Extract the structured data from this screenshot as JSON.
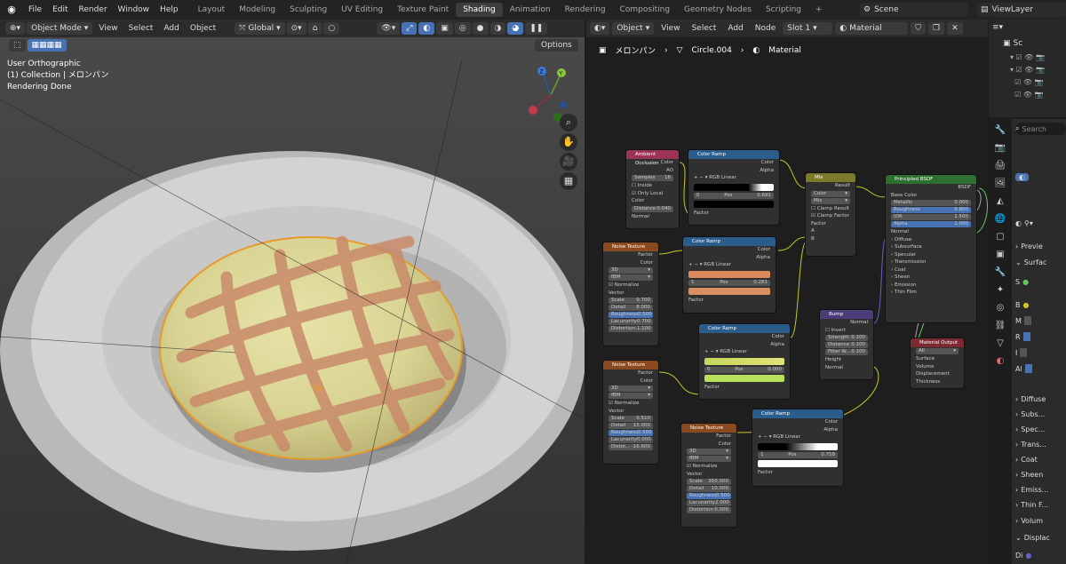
{
  "topbar": {
    "menus": [
      "File",
      "Edit",
      "Render",
      "Window",
      "Help"
    ],
    "workspaces": [
      "Layout",
      "Modeling",
      "Sculpting",
      "UV Editing",
      "Texture Paint",
      "Shading",
      "Animation",
      "Rendering",
      "Compositing",
      "Geometry Nodes",
      "Scripting"
    ],
    "active_workspace": "Shading",
    "scene": "Scene",
    "view_layer": "ViewLayer"
  },
  "viewport": {
    "mode": "Object Mode",
    "menus": [
      "View",
      "Select",
      "Add",
      "Object"
    ],
    "transform": "Global",
    "options": "Options",
    "info_lines": [
      "User Orthographic",
      "(1) Collection | メロンパン",
      "Rendering Done"
    ],
    "gizmo_labels": {
      "x": "X",
      "y": "Y",
      "z": "Z"
    }
  },
  "node_editor": {
    "type": "Object",
    "menus": [
      "View",
      "Select",
      "Add",
      "Node"
    ],
    "slot": "Slot 1",
    "material": "Material",
    "breadcrumb": [
      "メロンパン",
      "Circle.004",
      "Material"
    ],
    "nodes": {
      "ao": {
        "title": "Ambient Occlusion",
        "out1": "Color",
        "out2": "AO",
        "samples_label": "Samples",
        "samples": "16",
        "inside": "Inside",
        "only_local": "Only Local",
        "color": "Color",
        "distance_label": "Distance",
        "distance": "0.040",
        "normal": "Normal"
      },
      "cr1": {
        "title": "Color Ramp",
        "out1": "Color",
        "out2": "Alpha",
        "mode": "RGB",
        "interp": "Linear",
        "idx": "0",
        "pos_label": "Pos",
        "pos": "0.691",
        "factor": "Factor"
      },
      "mix": {
        "title": "Mix",
        "result": "Result",
        "type": "Color",
        "blend": "Mix",
        "clamp_result": "Clamp Result",
        "clamp_factor": "Clamp Factor",
        "factor": "Factor",
        "a": "A",
        "b": "B"
      },
      "bsdf": {
        "title": "Principled BSDF",
        "out": "BSDF",
        "base_color": "Base Color",
        "metallic_label": "Metallic",
        "metallic": "0.000",
        "roughness_label": "Roughness",
        "roughness": "0.800",
        "ior_label": "IOR",
        "ior": "1.500",
        "alpha_label": "Alpha",
        "alpha": "1.000",
        "normal": "Normal",
        "sections": [
          "Diffuse",
          "Subsurface",
          "Specular",
          "Transmission",
          "Coat",
          "Sheen",
          "Emission",
          "Thin Film"
        ]
      },
      "noise1": {
        "title": "Noise Texture",
        "out1": "Factor",
        "out2": "Color",
        "dim": "3D",
        "type": "fBM",
        "normalize": "Normalize",
        "vector": "Vector",
        "scale_label": "Scale",
        "scale": "9.700",
        "detail_label": "Detail",
        "detail": "8.000",
        "rough_label": "Roughness",
        "rough": "0.500",
        "lac_label": "Lacunarity",
        "lac": "0.700",
        "dist_label": "Distortion",
        "dist": "-1.100"
      },
      "cr2": {
        "title": "Color Ramp",
        "out1": "Color",
        "out2": "Alpha",
        "mode": "RGB",
        "interp": "Linear",
        "idx": "1",
        "pos_label": "Pos",
        "pos": "0.281",
        "factor": "Factor"
      },
      "cr3": {
        "title": "Color Ramp",
        "out1": "Color",
        "out2": "Alpha",
        "mode": "RGB",
        "interp": "Linear",
        "idx": "0",
        "pos_label": "Pos",
        "pos": "0.000",
        "factor": "Factor"
      },
      "bump": {
        "title": "Bump",
        "out": "Normal",
        "invert": "Invert",
        "strength_label": "Strength",
        "strength": "0.100",
        "distance_label": "Distance",
        "distance": "0.100",
        "filter_label": "Filter W...",
        "filter": "0.100",
        "height": "Height",
        "normal": "Normal"
      },
      "matout": {
        "title": "Material Output",
        "target": "All",
        "surface": "Surface",
        "volume": "Volume",
        "displacement": "Displacement",
        "thickness": "Thickness"
      },
      "noise2": {
        "title": "Noise Texture",
        "out1": "Factor",
        "out2": "Color",
        "dim": "3D",
        "type": "fBM",
        "normalize": "Normalize",
        "vector": "Vector",
        "scale_label": "Scale",
        "scale": "0.510",
        "detail_label": "Detail",
        "detail": "15.000",
        "rough_label": "Roughness",
        "rough": "0.500",
        "lac_label": "Lacunarity",
        "lac": "0.000",
        "dist_label": "Distor...",
        "dist": "-16.600"
      },
      "cr4": {
        "title": "Color Ramp",
        "out1": "Color",
        "out2": "Alpha",
        "mode": "RGB",
        "interp": "Linear",
        "idx": "1",
        "pos_label": "Pos",
        "pos": "0.758",
        "factor": "Factor"
      },
      "noise3": {
        "title": "Noise Texture",
        "out1": "Factor",
        "out2": "Color",
        "dim": "3D",
        "type": "fBM",
        "normalize": "Normalize",
        "vector": "Vector",
        "scale_label": "Scale",
        "scale": "350.000",
        "detail_label": "Detail",
        "detail": "10.000",
        "rough_label": "Roughness",
        "rough": "0.500",
        "lac_label": "Lacunarity",
        "lac": "2.000",
        "dist_label": "Distortion",
        "dist": "0.000"
      }
    }
  },
  "outliner": {
    "root": "Sc"
  },
  "properties": {
    "search_placeholder": "Search",
    "rows": [
      "Previe",
      "Surfac",
      "S",
      "B",
      "M",
      "R",
      "I",
      "Al",
      "Diffuse",
      "Subs...",
      "Spec...",
      "Trans...",
      "Coat",
      "Sheen",
      "Emiss...",
      "Thin F...",
      "Volum",
      "Displac",
      "Di"
    ]
  }
}
